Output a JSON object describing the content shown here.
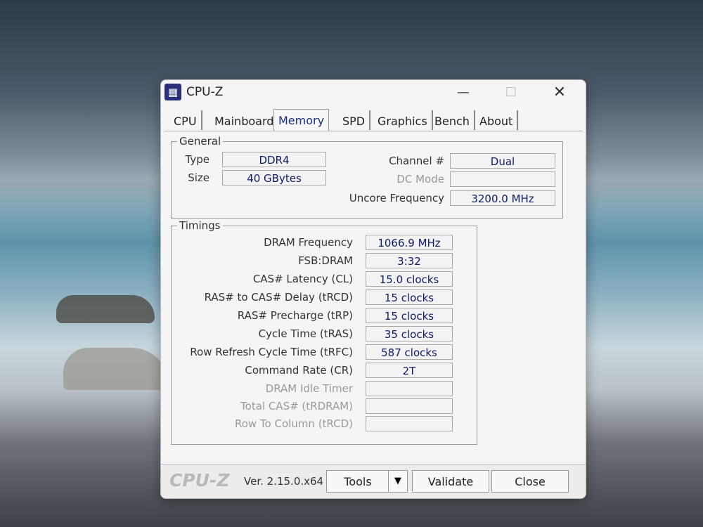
{
  "window": {
    "title": "CPU-Z",
    "min": "—",
    "max": "☐",
    "close": "✕"
  },
  "tabs": [
    {
      "label": "CPU"
    },
    {
      "label": "Mainboard"
    },
    {
      "label": "Memory"
    },
    {
      "label": "SPD"
    },
    {
      "label": "Graphics"
    },
    {
      "label": "Bench"
    },
    {
      "label": "About"
    }
  ],
  "active_tab": "Memory",
  "general": {
    "title": "General",
    "type_label": "Type",
    "type_value": "DDR4",
    "size_label": "Size",
    "size_value": "40 GBytes",
    "channel_label": "Channel #",
    "channel_value": "Dual",
    "dcmode_label": "DC Mode",
    "dcmode_value": "",
    "uncore_label": "Uncore Frequency",
    "uncore_value": "3200.0 MHz"
  },
  "timings": {
    "title": "Timings",
    "rows": [
      {
        "label": "DRAM Frequency",
        "value": "1066.9 MHz",
        "enabled": true
      },
      {
        "label": "FSB:DRAM",
        "value": "3:32",
        "enabled": true
      },
      {
        "label": "CAS# Latency (CL)",
        "value": "15.0 clocks",
        "enabled": true
      },
      {
        "label": "RAS# to CAS# Delay (tRCD)",
        "value": "15 clocks",
        "enabled": true
      },
      {
        "label": "RAS# Precharge (tRP)",
        "value": "15 clocks",
        "enabled": true
      },
      {
        "label": "Cycle Time (tRAS)",
        "value": "35 clocks",
        "enabled": true
      },
      {
        "label": "Row Refresh Cycle Time (tRFC)",
        "value": "587 clocks",
        "enabled": true
      },
      {
        "label": "Command Rate (CR)",
        "value": "2T",
        "enabled": true
      },
      {
        "label": "DRAM Idle Timer",
        "value": "",
        "enabled": false
      },
      {
        "label": "Total CAS# (tRDRAM)",
        "value": "",
        "enabled": false
      },
      {
        "label": "Row To Column (tRCD)",
        "value": "",
        "enabled": false
      }
    ]
  },
  "footer": {
    "brand": "CPU-Z",
    "version": "Ver. 2.15.0.x64",
    "tools": "Tools",
    "tools_arrow": "▼",
    "validate": "Validate",
    "close": "Close"
  }
}
